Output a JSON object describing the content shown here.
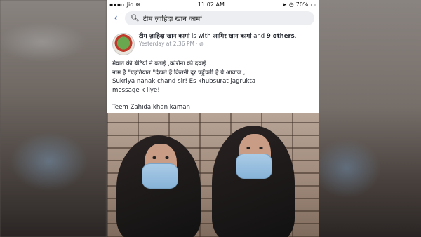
{
  "status_bar": {
    "carrier": "Jio",
    "time": "11:02 AM",
    "battery": "70%"
  },
  "search": {
    "query": "टीम ज़ाहिदा खान कामां"
  },
  "post": {
    "author": "टीम ज़ाहिदा खान कामां",
    "with_text": "is with",
    "tagged": "आमिर खान कामां",
    "and_text": "and",
    "others": "9 others",
    "timestamp": "Yesterday at 2:36 PM",
    "audience_icon": "globe-icon",
    "body_lines": [
      "मेवात की बेटियों ने बताई ,कोरोना की दवाई",
      "नाम है \"एहतियात \"देखते हैं कितनी दूर पहुँचती है ये आवाज ,",
      "Sukriya nanak chand sir! Es khubsurat jagrukta",
      "message k liye!"
    ],
    "signoff": "Teem Zahida khan kaman"
  },
  "colors": {
    "link": "#4267b2",
    "mask": "#a9cbe6"
  }
}
